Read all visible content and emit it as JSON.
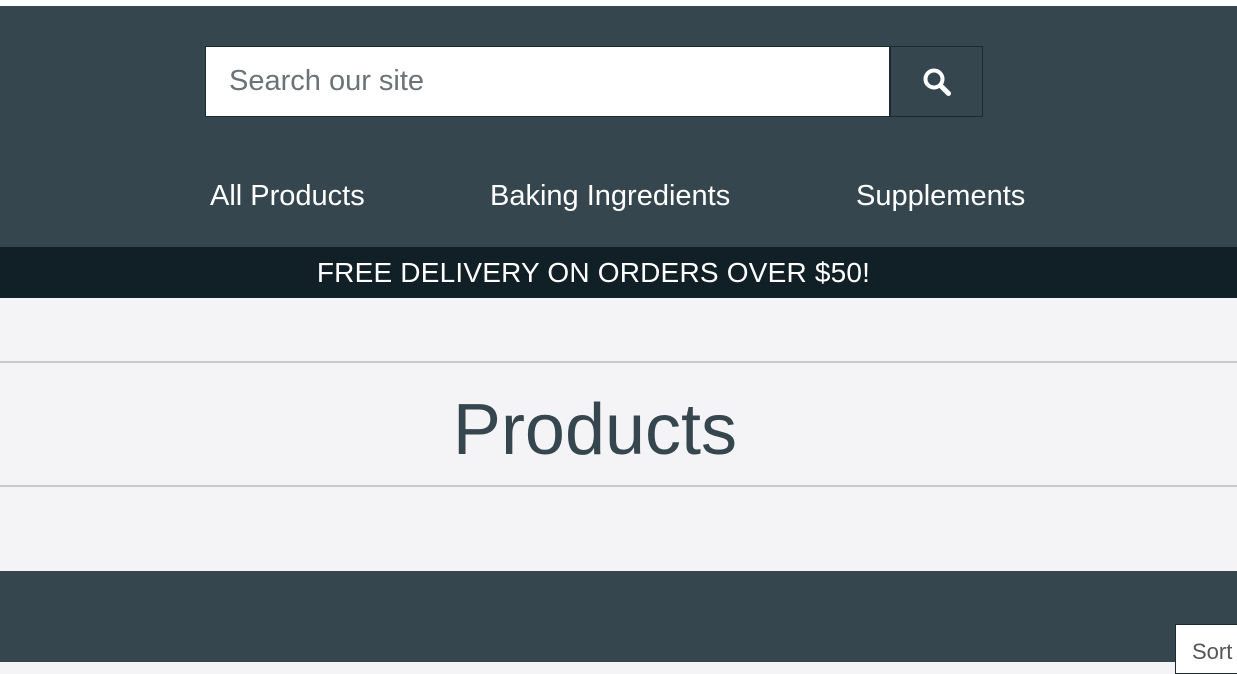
{
  "search": {
    "placeholder": "Search our site",
    "button_icon": "search-icon"
  },
  "nav": {
    "items": [
      {
        "label": "All Products"
      },
      {
        "label": "Baking Ingredients"
      },
      {
        "label": "Supplements"
      }
    ]
  },
  "banner": {
    "text": "FREE DELIVERY ON ORDERS OVER $50!"
  },
  "page": {
    "title": "Products"
  },
  "sort": {
    "label": "Sort"
  },
  "colors": {
    "header_bg": "#36464f",
    "banner_bg": "#111f26",
    "page_bg": "#f4f4f6",
    "title_text": "#36464f"
  }
}
